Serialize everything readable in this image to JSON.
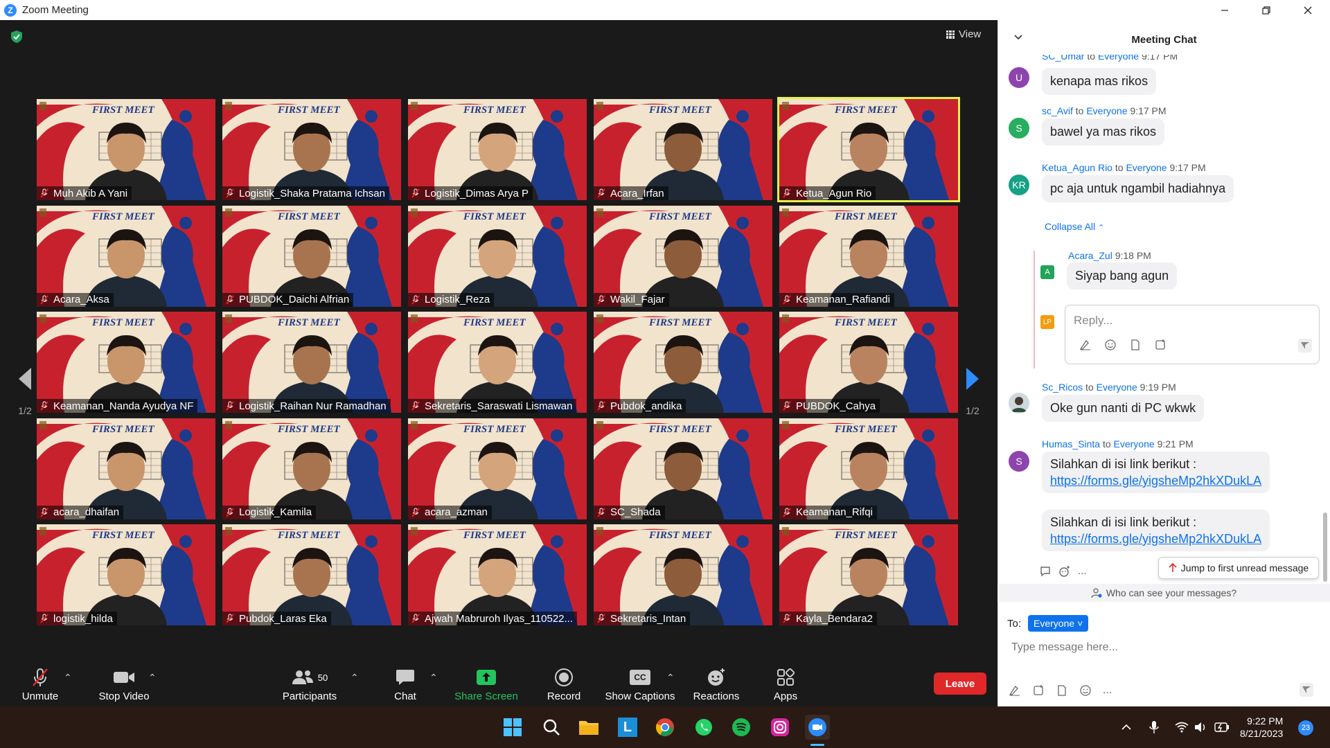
{
  "window": {
    "title": "Zoom Meeting"
  },
  "stage": {
    "view_label": "View",
    "page_indicator_left": "1/2",
    "page_indicator_right": "1/2",
    "banner_text": "FIRST MEET",
    "participants": [
      {
        "name": "Muh Akib A Yani",
        "active": false
      },
      {
        "name": "Logistik_Shaka Pratama Ichsan",
        "active": false
      },
      {
        "name": "Logistik_Dimas Arya P",
        "active": false
      },
      {
        "name": "Acara_Irfan",
        "active": false
      },
      {
        "name": "Ketua_Agun Rio",
        "active": true
      },
      {
        "name": "Acara_Aksa",
        "active": false
      },
      {
        "name": "PUBDOK_Daichi Alfrian",
        "active": false
      },
      {
        "name": "Logistik_Reza",
        "active": false
      },
      {
        "name": "Wakil_Fajar",
        "active": false
      },
      {
        "name": "Keamanan_Rafiandi",
        "active": false
      },
      {
        "name": "Keamanan_Nanda Ayudya NF",
        "active": false
      },
      {
        "name": "Logistik_Raihan Nur Ramadhan",
        "active": false
      },
      {
        "name": "Sekretaris_Saraswati Lismawan",
        "active": false
      },
      {
        "name": "Pubdok_andika",
        "active": false
      },
      {
        "name": "PUBDOK_Cahya",
        "active": false
      },
      {
        "name": "acara_dhaifan",
        "active": false
      },
      {
        "name": "Logistik_Kamila",
        "active": false
      },
      {
        "name": "acara_azman",
        "active": false
      },
      {
        "name": "SC_Shada",
        "active": false
      },
      {
        "name": "Keamanan_Rifqi",
        "active": false
      },
      {
        "name": "logistik_hilda",
        "active": false
      },
      {
        "name": "Pubdok_Laras Eka",
        "active": false
      },
      {
        "name": "Ajwah Mabruroh Ilyas_110522...",
        "active": false
      },
      {
        "name": "Sekretaris_Intan",
        "active": false
      },
      {
        "name": "Kayla_Bendara2",
        "active": false
      }
    ]
  },
  "toolbar": {
    "unmute": "Unmute",
    "stop_video": "Stop Video",
    "participants": "Participants",
    "participants_count": "50",
    "chat": "Chat",
    "share_screen": "Share Screen",
    "record": "Record",
    "show_captions": "Show Captions",
    "captions_icon": "CC",
    "reactions": "Reactions",
    "apps": "Apps",
    "leave": "Leave"
  },
  "chat": {
    "title": "Meeting Chat",
    "messages": [
      {
        "sender": "SC_Umar",
        "to": "to",
        "audience": "Everyone",
        "time": "9:17 PM",
        "text": "kenapa mas rikos",
        "avatar": "U",
        "color": "#8e44ad"
      },
      {
        "sender": "sc_Avif",
        "to": "to",
        "audience": "Everyone",
        "time": "9:17 PM",
        "text": "bawel ya mas rikos",
        "avatar": "S",
        "color": "#27ae60"
      },
      {
        "sender": "Ketua_Agun Rio",
        "to": "to",
        "audience": "Everyone",
        "time": "9:17 PM",
        "text": "pc aja untuk ngambil hadiahnya",
        "avatar": "KR",
        "color": "#16a085"
      },
      {
        "sender": "Sc_Ricos",
        "to": "to",
        "audience": "Everyone",
        "time": "9:19 PM",
        "text": "Oke gun nanti di PC wkwk",
        "avatar": "",
        "color": "#555555"
      },
      {
        "sender": "Humas_Sinta",
        "to": "to",
        "audience": "Everyone",
        "time": "9:21 PM",
        "text": "Silahkan di isi link berikut :",
        "link": "https://forms.gle/yigsheMp2hkXDukLA",
        "avatar": "S",
        "color": "#8e44ad"
      }
    ],
    "repeat_text": "Silahkan di isi link berikut :",
    "repeat_link": "https://forms.gle/yigsheMp2hkXDukLA",
    "collapse_all": "Collapse All",
    "thread_reply": {
      "sender": "Acara_Zul",
      "time": "9:18 PM",
      "text": "Siyap bang agun",
      "avatar": "A"
    },
    "reply_avatar": "LP",
    "reply_placeholder": "Reply...",
    "ellipsis": "...",
    "jump_label": "Jump to first unread message",
    "who_can_see": "Who can see your messages?",
    "to_label": "To:",
    "to_value": "Everyone",
    "type_placeholder": "Type message here..."
  },
  "taskbar": {
    "time": "9:22 PM",
    "date": "8/21/2023",
    "notifications": "23"
  }
}
